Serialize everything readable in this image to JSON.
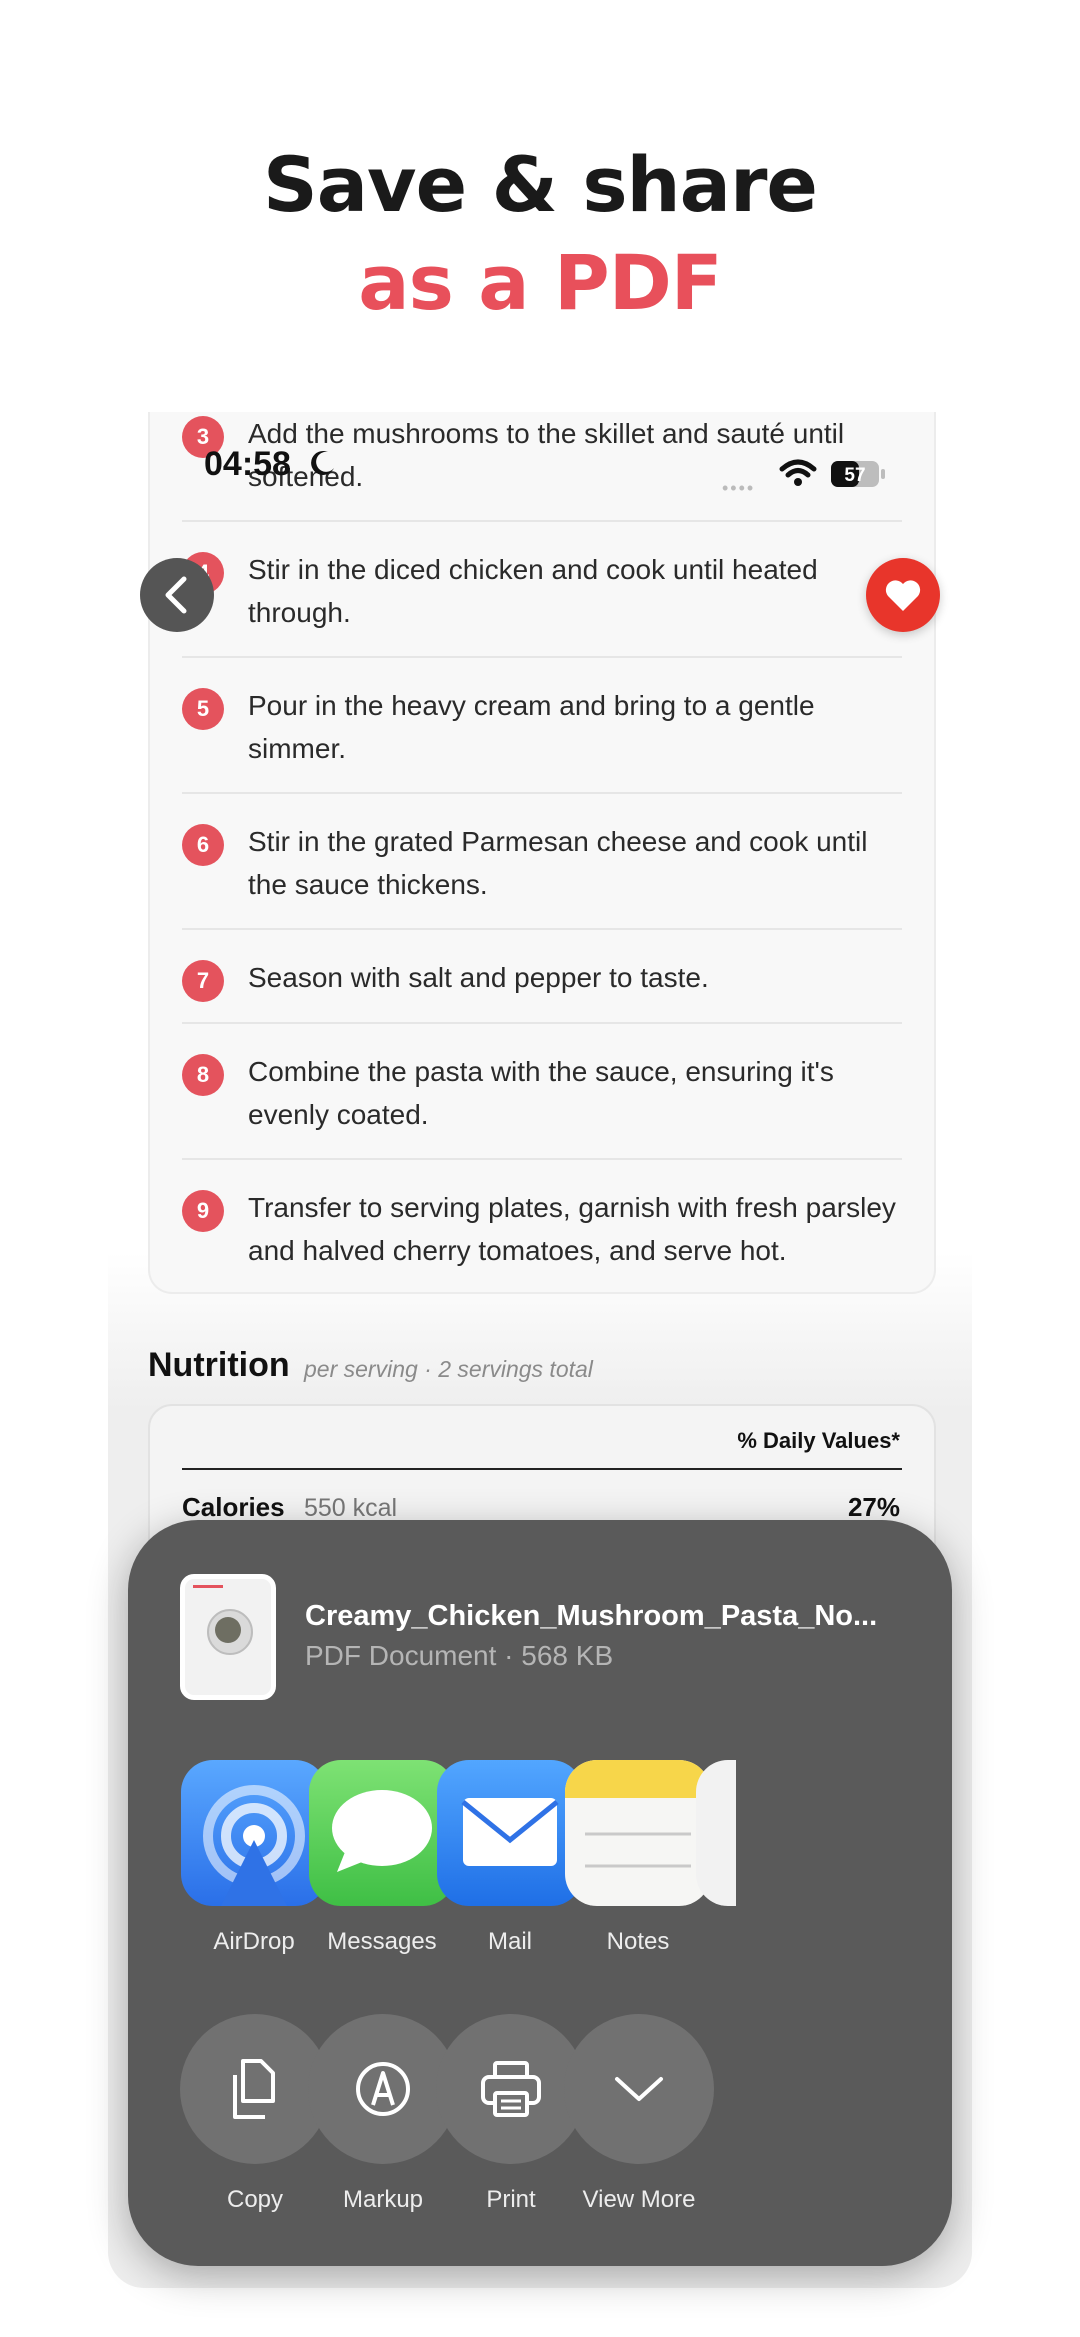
{
  "headline": {
    "line1": "Save & share",
    "line2": "as a PDF"
  },
  "status_bar": {
    "time": "04:58",
    "battery": "57"
  },
  "steps": [
    {
      "num": "3",
      "text": "Add the mushrooms to the skillet and sauté until softened."
    },
    {
      "num": "4",
      "text": "Stir in the diced chicken and cook until heated through."
    },
    {
      "num": "5",
      "text": "Pour in the heavy cream and bring to a gentle simmer."
    },
    {
      "num": "6",
      "text": "Stir in the grated Parmesan cheese and cook until the sauce thickens."
    },
    {
      "num": "7",
      "text": "Season with salt and pepper to taste."
    },
    {
      "num": "8",
      "text": "Combine the pasta with the sauce, ensuring it's evenly coated."
    },
    {
      "num": "9",
      "text": "Transfer to serving plates, garnish with fresh parsley and halved cherry tomatoes, and serve hot."
    }
  ],
  "nutrition": {
    "title": "Nutrition",
    "subtitle": "per serving · 2 servings total",
    "dv_header": "% Daily Values*",
    "calories_label": "Calories",
    "calories_value": "550 kcal",
    "calories_pct": "27%"
  },
  "share_sheet": {
    "file_name": "Creamy_Chicken_Mushroom_Pasta_No...",
    "file_meta": "PDF Document · 568 KB",
    "apps": [
      {
        "label": "AirDrop",
        "icon": "airdrop-icon"
      },
      {
        "label": "Messages",
        "icon": "messages-icon"
      },
      {
        "label": "Mail",
        "icon": "mail-icon"
      },
      {
        "label": "Notes",
        "icon": "notes-icon"
      }
    ],
    "actions": [
      {
        "label": "Copy",
        "icon": "copy-icon"
      },
      {
        "label": "Markup",
        "icon": "markup-icon"
      },
      {
        "label": "Print",
        "icon": "print-icon"
      },
      {
        "label": "View More",
        "icon": "chevron-down-icon"
      }
    ]
  },
  "colors": {
    "accent": "#e4535d",
    "heart": "#e8352b",
    "sheet": "#5a5a5a"
  }
}
